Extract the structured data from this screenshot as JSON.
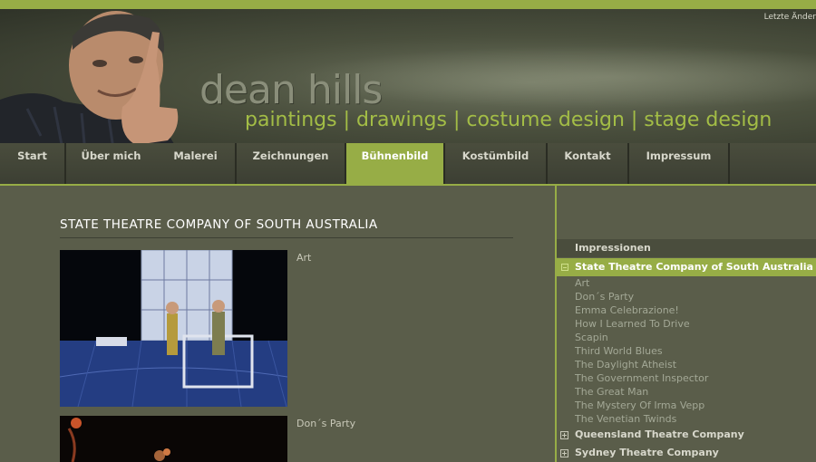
{
  "header": {
    "last_change": "Letzte Änder",
    "brand_name": "dean hills",
    "tagline": "paintings | drawings | costume design | stage design"
  },
  "nav": {
    "items": [
      {
        "label": "Start"
      },
      {
        "label": "Über mich"
      },
      {
        "label": "Malerei"
      },
      {
        "label": "Zeichnungen"
      },
      {
        "label": "Bühnenbild"
      },
      {
        "label": "Kostümbild"
      },
      {
        "label": "Kontakt"
      },
      {
        "label": "Impressum"
      }
    ],
    "active": "Bühnenbild"
  },
  "main": {
    "title": "STATE THEATRE COMPANY OF SOUTH AUSTRALIA",
    "entries": [
      {
        "caption": "Art"
      },
      {
        "caption": "Don´s Party"
      }
    ]
  },
  "sidebar": {
    "section_header": "Impressionen",
    "active_company": "State Theatre Company of South Australia",
    "productions": [
      "Art",
      "Don´s Party",
      "Emma Celebrazione!",
      "How I Learned To Drive",
      "Scapin",
      "Third World Blues",
      "The Daylight Atheist",
      "The Government Inspector",
      "The Great Man",
      "The Mystery Of Irma Vepp",
      "The Venetian Twinds"
    ],
    "companies": [
      "Queensland Theatre Company",
      "Sydney Theatre Company"
    ]
  },
  "colors": {
    "accent": "#97ad46",
    "background": "#5a5d4a",
    "nav_background": "#3c3f33"
  }
}
